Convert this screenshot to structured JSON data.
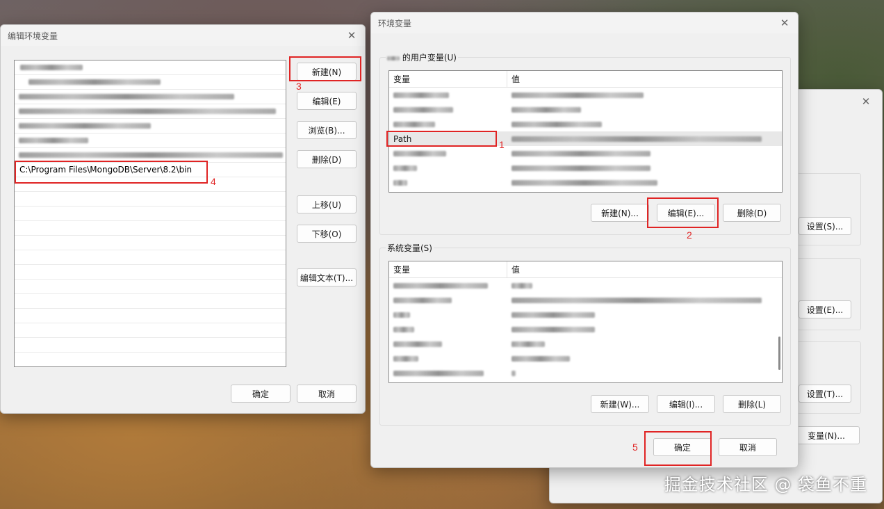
{
  "edit_dialog": {
    "title": "编辑环境变量",
    "path_entry": "C:\\Program Files\\MongoDB\\Server\\8.2\\bin",
    "buttons": {
      "new": "新建(N)",
      "edit": "编辑(E)",
      "browse": "浏览(B)...",
      "delete": "删除(D)",
      "move_up": "上移(U)",
      "move_down": "下移(O)",
      "edit_text": "编辑文本(T)...",
      "ok": "确定",
      "cancel": "取消"
    }
  },
  "env_dialog": {
    "title": "环境变量",
    "user_group_title": "的用户变量(U)",
    "system_group_title": "系统变量(S)",
    "col_variable": "变量",
    "col_value": "值",
    "selected_user_var": "Path",
    "user_buttons": {
      "new": "新建(N)...",
      "edit": "编辑(E)...",
      "delete": "删除(D)"
    },
    "system_buttons": {
      "new": "新建(W)...",
      "edit": "编辑(I)...",
      "delete": "删除(L)"
    },
    "ok": "确定",
    "cancel": "取消"
  },
  "back_dialog": {
    "settings_s": "设置(S)...",
    "settings_e": "设置(E)...",
    "settings_t": "设置(T)...",
    "env_vars": "变量(N)..."
  },
  "annotations": {
    "n1": "1",
    "n2": "2",
    "n3": "3",
    "n4": "4",
    "n5": "5"
  },
  "watermark": "掘金技术社区 @ 袋鱼不重",
  "colors": {
    "annotation_red": "#e02424",
    "window_bg": "#f0f0f0"
  }
}
